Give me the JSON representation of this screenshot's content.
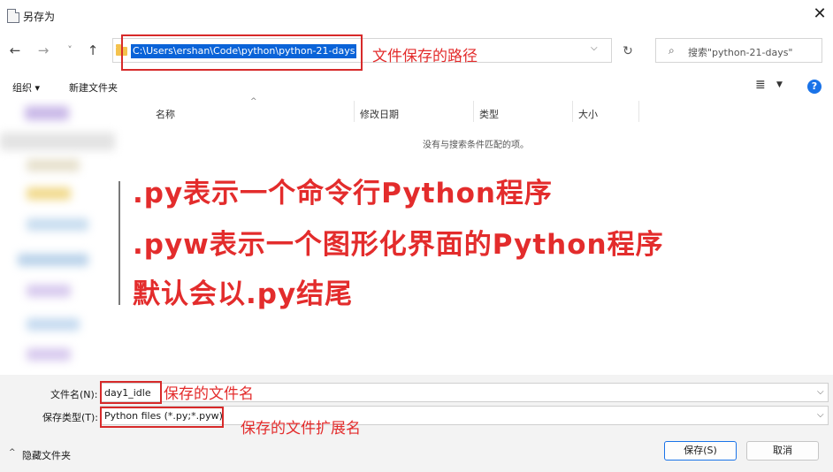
{
  "window": {
    "title": "另存为"
  },
  "nav": {
    "back": "←",
    "forward": "→",
    "recent": "˅",
    "up": "↑",
    "refresh": "↻"
  },
  "address": {
    "path": "C:\\Users\\ershan\\Code\\python\\python-21-days"
  },
  "search": {
    "placeholder": "搜索\"python-21-days\""
  },
  "toolbar": {
    "organize": "组织 ▾",
    "new_folder": "新建文件夹"
  },
  "columns": [
    "名称",
    "修改日期",
    "类型",
    "大小"
  ],
  "empty_message": "没有与搜索条件匹配的项。",
  "annotations": {
    "path_note": "文件保存的路径",
    "line1": ".py表示一个命令行Python程序",
    "line2": ".pyw表示一个图形化界面的Python程序",
    "line3": "默认会以.py结尾",
    "filename_note": "保存的文件名",
    "type_note": "保存的文件扩展名"
  },
  "form": {
    "filename_label": "文件名(N):",
    "filename_value": "day1_idle",
    "type_label": "保存类型(T):",
    "type_value": "Python files (*.py;*.pyw)"
  },
  "footer": {
    "hide_folders": "隐藏文件夹",
    "save": "保存(S)",
    "cancel": "取消"
  },
  "icons": [
    "file-icon",
    "close-icon",
    "back-icon",
    "forward-icon",
    "recent-chevron-icon",
    "up-icon",
    "folder-icon",
    "chevron-down-icon",
    "refresh-icon",
    "search-icon",
    "view-icon",
    "help-icon",
    "sort-arrow-icon"
  ],
  "colors": {
    "accent": "#1a73e8",
    "annotation": "#e32c2c",
    "selection": "#0a63d8"
  }
}
